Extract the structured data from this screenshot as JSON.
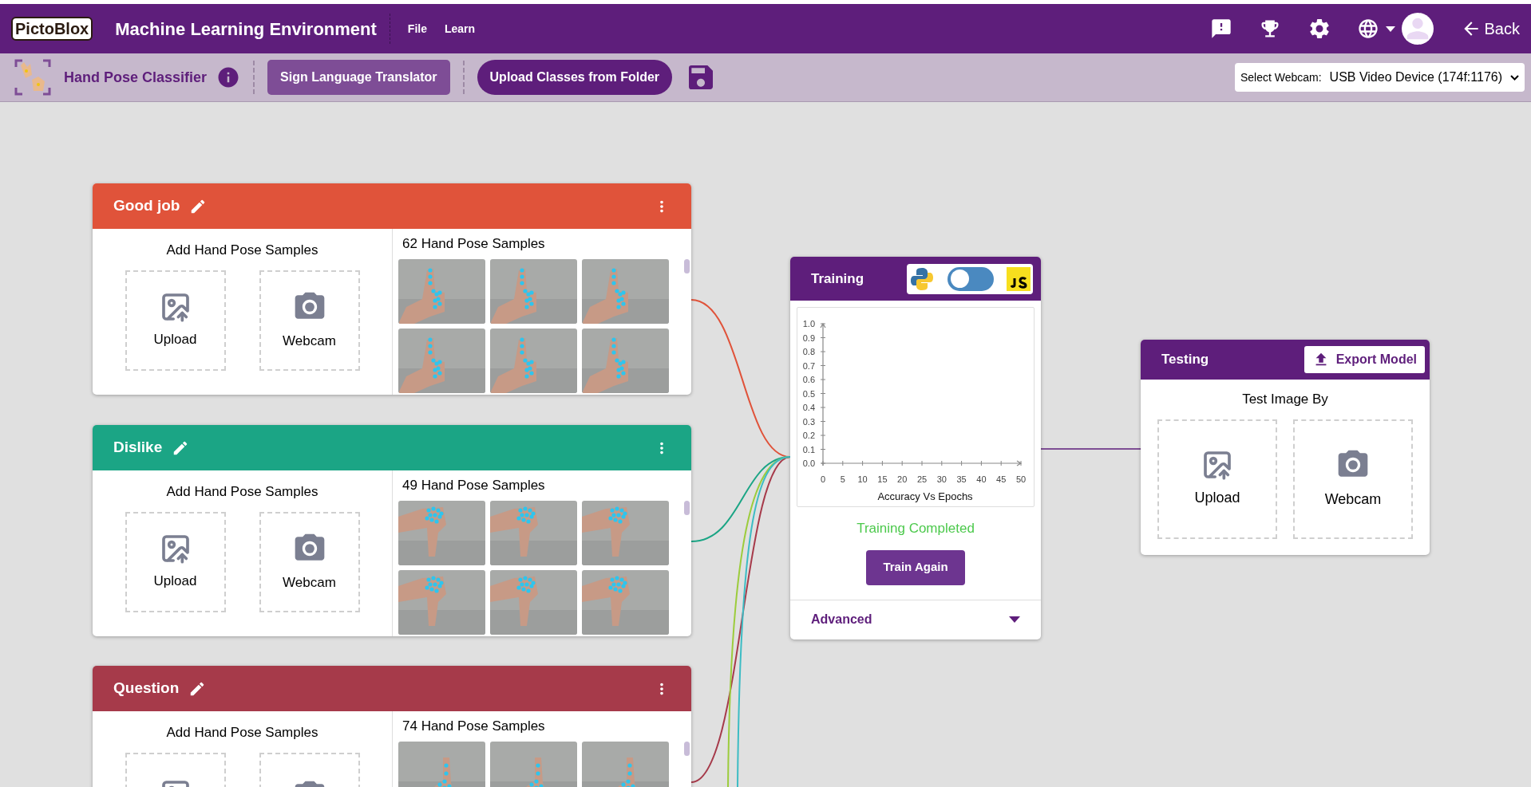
{
  "header": {
    "logo": "PictoBlox",
    "title": "Machine Learning Environment",
    "menu": [
      "File",
      "Learn"
    ],
    "back": "Back"
  },
  "toolbar": {
    "project": "Hand Pose Classifier",
    "buttons": [
      {
        "label": "Sign Language Translator",
        "kind": "square"
      },
      {
        "label": "Upload Classes from Folder",
        "kind": "pill"
      }
    ],
    "webcam_label": "Select Webcam:",
    "webcam_value": "USB Video Device (174f:1176)"
  },
  "classes": [
    {
      "name": "Good job",
      "color": "#e0533a",
      "add_title": "Add Hand Pose Samples",
      "upload": "Upload",
      "webcam": "Webcam",
      "count": "62 Hand Pose Samples"
    },
    {
      "name": "Dislike",
      "color": "#1ba585",
      "add_title": "Add Hand Pose Samples",
      "upload": "Upload",
      "webcam": "Webcam",
      "count": "49 Hand Pose Samples"
    },
    {
      "name": "Question",
      "color": "#a63a4a",
      "add_title": "Add Hand Pose Samples",
      "count": "74 Hand Pose Samples"
    }
  ],
  "offscreen_links": [
    {
      "color": "#9ccc3c"
    },
    {
      "color": "#3cbcc4"
    }
  ],
  "training": {
    "title": "Training",
    "language_toggle": {
      "on": false
    },
    "chart_data": {
      "type": "line",
      "xlabel": "Accuracy Vs Epochs",
      "xlim": [
        0,
        50
      ],
      "ylim": [
        0,
        1
      ],
      "xticks": [
        0,
        5,
        10,
        15,
        20,
        25,
        30,
        35,
        40,
        45,
        50
      ],
      "yticks": [
        {
          "value": 0,
          "label": "0.0"
        },
        {
          "value": 0.1,
          "label": "0.1"
        },
        {
          "value": 0.2,
          "label": "0.2"
        },
        {
          "value": 0.3,
          "label": "0.3"
        },
        {
          "value": 0.4,
          "label": "0.4"
        },
        {
          "value": 0.5,
          "label": "0.5"
        },
        {
          "value": 0.6,
          "label": "0.6"
        },
        {
          "value": 0.7,
          "label": "0.7"
        },
        {
          "value": 0.8,
          "label": "0.8"
        },
        {
          "value": 0.9,
          "label": "0.9"
        },
        {
          "value": 1,
          "label": "1.0"
        }
      ]
    },
    "status": "Training Completed",
    "button": "Train Again",
    "advanced": {
      "label": "Advanced",
      "expanded": false
    }
  },
  "testing": {
    "title": "Testing",
    "export": "Export Model",
    "subtitle": "Test Image By",
    "upload": "Upload",
    "webcam": "Webcam"
  }
}
